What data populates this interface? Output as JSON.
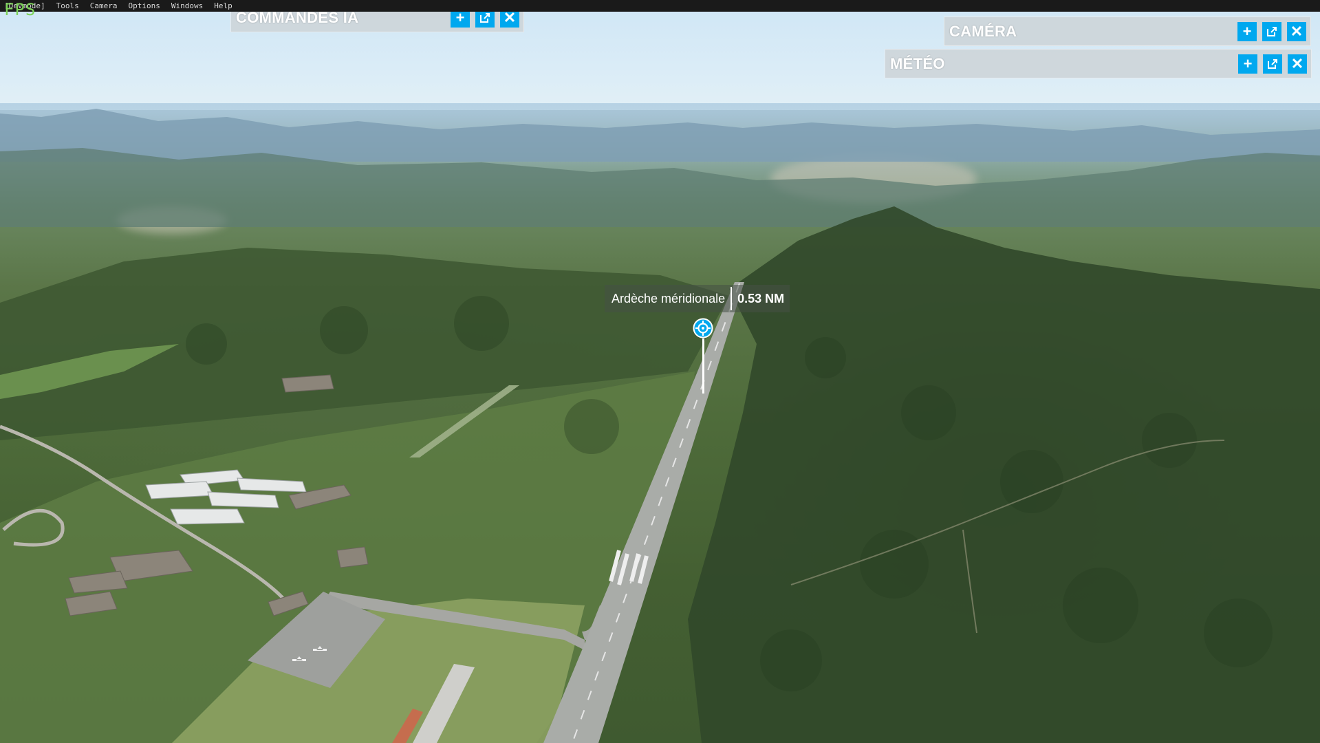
{
  "menubar": {
    "items": [
      "[Devmode]",
      "Tools",
      "Camera",
      "Options",
      "Windows",
      "Help"
    ],
    "fps_text": "FPS"
  },
  "panels": {
    "ai_controls": {
      "title": "COMMANDES IA"
    },
    "camera": {
      "title": "CAMÉRA"
    },
    "weather": {
      "title": "MÉTÉO"
    },
    "buttons": {
      "add": "+",
      "close": "✕"
    }
  },
  "poi": {
    "name": "Ardèche méridionale",
    "distance": "0.53 NM",
    "icon": "target-icon"
  },
  "colors": {
    "accent": "#00a8ef",
    "panel_bg": "#cdd4d8",
    "fps_green": "#7dd35a"
  }
}
